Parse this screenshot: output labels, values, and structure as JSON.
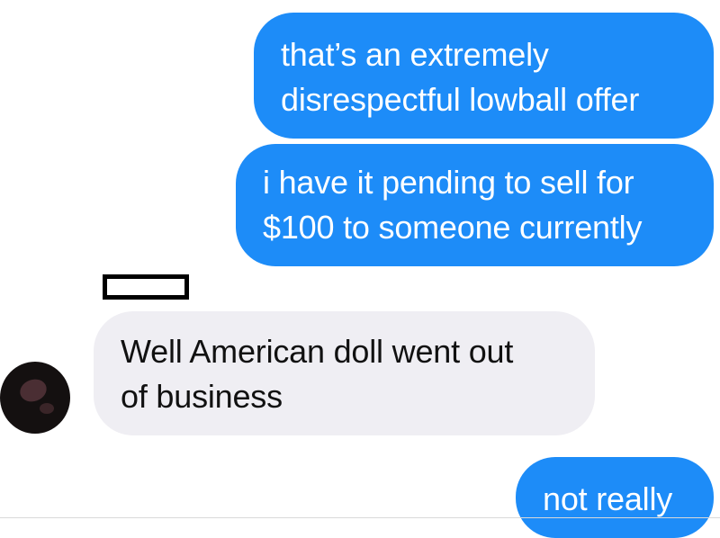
{
  "conversation": {
    "messages": [
      {
        "direction": "outgoing",
        "text": "that’s an extremely\ndisrespectful lowball offer"
      },
      {
        "direction": "outgoing",
        "text": "i have it pending to sell for\n$100 to someone currently"
      },
      {
        "direction": "incoming",
        "text": "Well American doll went out\nof business"
      },
      {
        "direction": "outgoing",
        "text": "not really"
      }
    ]
  },
  "colors": {
    "outgoing_bubble": "#1d8cf8",
    "incoming_bubble": "#efeef3",
    "background": "#ffffff"
  }
}
